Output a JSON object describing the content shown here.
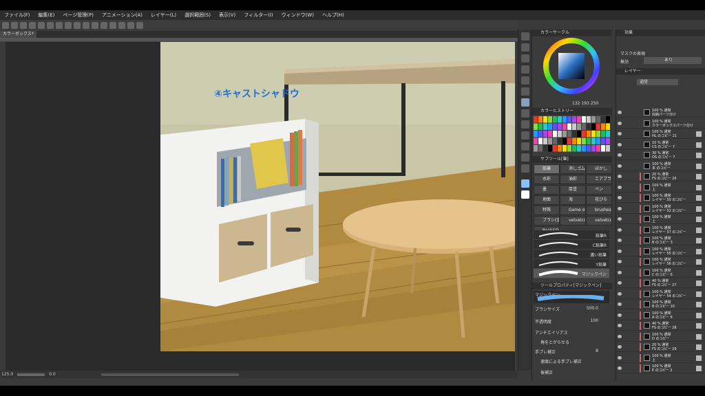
{
  "menu": [
    "ファイル(F)",
    "編集(E)",
    "ページ管理(P)",
    "アニメーション(A)",
    "レイヤー(L)",
    "選択範囲(S)",
    "表示(V)",
    "フィルター(I)",
    "ウィンドウ(W)",
    "ヘルプ(H)"
  ],
  "tab": {
    "label": "カラーボックス*"
  },
  "canvas": {
    "caption": "④キャストシャドウ"
  },
  "status": {
    "zoom": "125.0",
    "angle": "0.0"
  },
  "color_panel": {
    "title": "カラーサークル",
    "r": "132",
    "g": "193",
    "b": "250",
    "main_color": "#86c1fa"
  },
  "color_history": {
    "title": "カラーヒストリー"
  },
  "subtool": {
    "title": "サブツール[筆]",
    "items": [
      "鉛筆",
      "消しゴム",
      "ぼかし",
      "水彩",
      "油彩",
      "エアブラシ",
      "墨",
      "厚塗",
      "ペン",
      "地面",
      "海",
      "花びら",
      "特殊",
      "Game of",
      "brushes",
      "ブラシ(金)",
      "velvetco",
      "velvetco",
      "Rock&D"
    ]
  },
  "brushes": [
    "鉛筆R",
    "C鉛筆R",
    "濃い鉛筆",
    "Y鉛筆",
    "マジックペン"
  ],
  "tool_property": {
    "title": "ツールプロパティ[マジックペン]",
    "brush_name": "マジックペン",
    "brush_size_label": "ブラシサイズ",
    "brush_size": "500.0",
    "opacity_label": "不透明度",
    "opacity": "100",
    "antialias_label": "アンチエイリアス",
    "corner_label": "角をとがらせる",
    "stabilizer_label": "手ブレ補正",
    "stabilizer": "8",
    "speed_label": "速度による手ブレ補正",
    "post_label": "後補正"
  },
  "effects": {
    "title": "効果",
    "mask_label": "マスクの表現",
    "mask_none": "無効",
    "mask_value": "あり"
  },
  "layer_panel": {
    "title": "レイヤー",
    "blend": "通常"
  },
  "layers": [
    {
      "l1": "100 % 通常",
      "l2": "収納パーツ分け"
    },
    {
      "l1": "100 % 通常",
      "l2": "カラーボックスパーツ分け"
    },
    {
      "l1": "100 % 通常",
      "l2": "HL のコピー 21"
    },
    {
      "l1": "10 % 通常",
      "l2": "CS のコピー 7"
    },
    {
      "l1": "30 % 通常",
      "l2": "OS のコピー 7"
    },
    {
      "l1": "100 % 通常",
      "l2": "本 のコピー"
    },
    {
      "l1": "20 % 通常",
      "l2": "FS のコピー 26"
    },
    {
      "l1": "100 % 通常",
      "l2": "上"
    },
    {
      "l1": "100 % 通常",
      "l2": "レイヤー 50 のコピー"
    },
    {
      "l1": "100 % 通常",
      "l2": "レイヤー 52 のコピー"
    },
    {
      "l1": "100 % 通常",
      "l2": "上"
    },
    {
      "l1": "100 % 通常",
      "l2": "レイヤー 57 のコピー"
    },
    {
      "l1": "100 % 通常",
      "l2": "B のコピー 3"
    },
    {
      "l1": "100 % 通常",
      "l2": "レイヤー 55 のコピー"
    },
    {
      "l1": "100 % 通常",
      "l2": "レイヤー 56 のコピー"
    },
    {
      "l1": "100 % 通常",
      "l2": "C のコピー 6"
    },
    {
      "l1": "40 % 通常",
      "l2": "FS のコピー 27"
    },
    {
      "l1": "100 % 通常",
      "l2": "レイヤー 54 のコピー"
    },
    {
      "l1": "100 % 通常",
      "l2": "B のコピー 10"
    },
    {
      "l1": "100 % 通常",
      "l2": "A のコピー 6"
    },
    {
      "l1": "40 % 通常",
      "l2": "FS のコピー 28"
    },
    {
      "l1": "100 % 通常",
      "l2": "D のコピー"
    },
    {
      "l1": "20 % 通常",
      "l2": "FS のコピー 29"
    },
    {
      "l1": "100 % 通常",
      "l2": "上"
    },
    {
      "l1": "100 % 通常",
      "l2": "E のコピー 2"
    }
  ]
}
